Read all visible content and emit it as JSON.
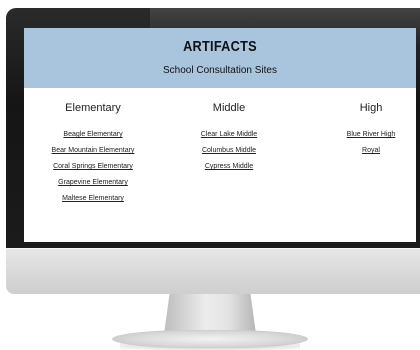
{
  "site": {
    "title": "ARTIFACTS",
    "subtitle": "School Consultation Sites",
    "banner_color": "#a9c4dd"
  },
  "columns": [
    {
      "heading": "Elementary",
      "links": [
        "Beagle Elementary",
        "Bear Mountain Elementary",
        "Coral Springs Elementary",
        "Grapevine Elementary",
        "Maltese Elementary"
      ]
    },
    {
      "heading": "Middle",
      "links": [
        "Clear Lake Middle",
        "Columbus Middle",
        "Cypress Middle"
      ]
    },
    {
      "heading": "High",
      "links": [
        "Blue River High",
        "Royal"
      ]
    }
  ]
}
